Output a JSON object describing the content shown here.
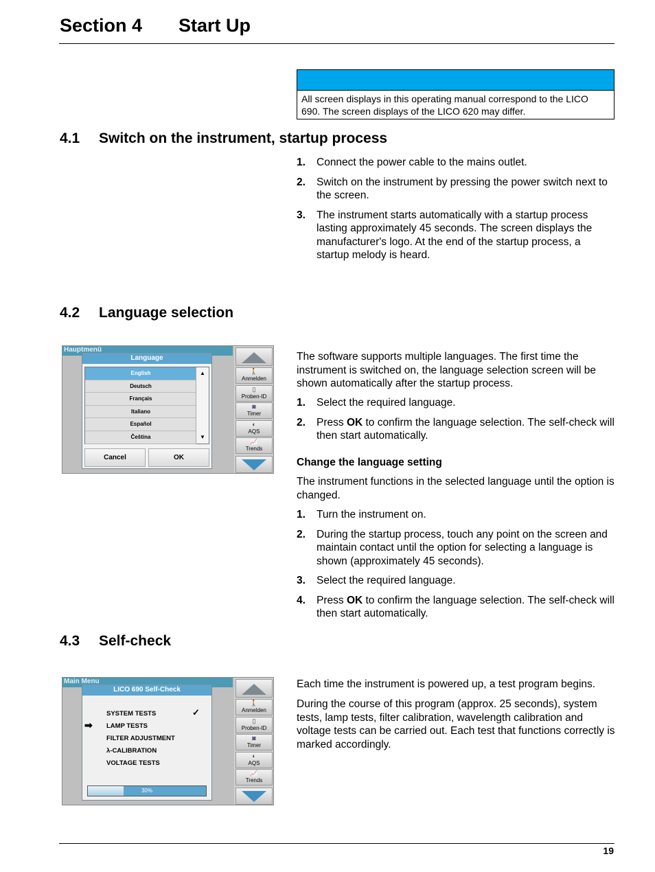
{
  "header": {
    "section": "Section 4",
    "title": "Start Up"
  },
  "note": {
    "text": "All screen displays in this operating manual correspond to the LICO 690. The screen displays of the LICO 620 may differ.",
    "bar_color": "#00a6eb"
  },
  "s41": {
    "num": "4.1",
    "title": "Switch on the instrument, startup process",
    "steps": [
      "Connect the power cable to the mains outlet.",
      "Switch on the instrument by pressing the power switch next to the screen.",
      "The instrument starts automatically with a startup process lasting approximately 45 seconds. The screen displays the manufacturer's logo. At the end of the startup process, a startup melody is heard."
    ]
  },
  "s42": {
    "num": "4.2",
    "title": "Language selection",
    "intro": "The software supports multiple languages. The first time the instrument is switched on, the language selection screen will be shown automatically after the startup process.",
    "steps": [
      {
        "pre": "Select the required language.",
        "b": "",
        "post": ""
      },
      {
        "pre": "Press ",
        "b": "OK",
        "post": " to confirm the language selection. The self-check will then start automatically."
      }
    ],
    "sub": "Change the language setting",
    "sub_intro": "The instrument functions in the selected language until the option is changed.",
    "steps2": [
      {
        "pre": "Turn the instrument on.",
        "b": "",
        "post": ""
      },
      {
        "pre": "During the startup process, touch any point on the screen and maintain contact until the option for selecting a language is shown (approximately 45 seconds).",
        "b": "",
        "post": ""
      },
      {
        "pre": "Select the required language.",
        "b": "",
        "post": ""
      },
      {
        "pre": "Press ",
        "b": "OK",
        "post": " to confirm the language selection. The self-check will then start automatically."
      }
    ],
    "screen": {
      "bg_title": "Hauptmenü",
      "dialog_title": "Language",
      "languages": [
        "English",
        "Deutsch",
        "Français",
        "Italiano",
        "Español",
        "Čeština"
      ],
      "selected": "English",
      "cancel": "Cancel",
      "ok": "OK"
    }
  },
  "s43": {
    "num": "4.3",
    "title": "Self-check",
    "p1": "Each time the instrument is powered up, a test program begins.",
    "p2": "During the course of this program (approx. 25 seconds), system tests, lamp tests, filter calibration, wavelength calibration and voltage tests can be carried out. Each test that functions correctly is marked accordingly.",
    "screen": {
      "bg_title": "Main Menu",
      "dialog_title": "LICO 690  Self-Check",
      "tests": [
        "SYSTEM TESTS",
        "LAMP TESTS",
        "FILTER ADJUSTMENT",
        "λ-CALIBRATION",
        "VOLTAGE TESTS"
      ],
      "done": [
        "SYSTEM TESTS"
      ],
      "current": "LAMP TESTS",
      "progress_label": "30%",
      "progress": 30
    }
  },
  "sidebar": [
    "Anmelden",
    "Proben-ID",
    "Timer",
    "AQS",
    "Trends"
  ],
  "page_number": "19"
}
